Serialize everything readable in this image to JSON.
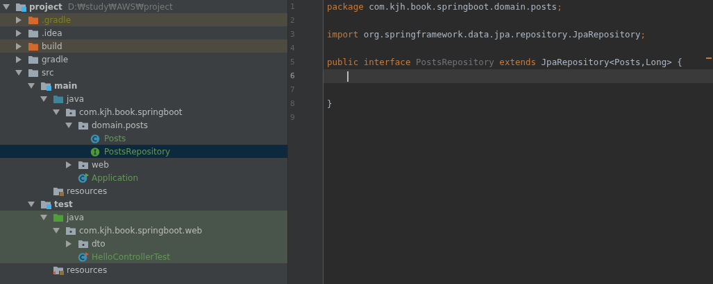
{
  "project_tree": {
    "items": [
      {
        "label": "project",
        "path": "D:₩study₩AWS₩project",
        "kind": "module",
        "color": "#bbbbbb",
        "selected": false,
        "expanded": true,
        "children": [
          {
            "label": ".gradle",
            "kind": "excluded-folder",
            "color": "#848504",
            "selected": false,
            "expanded": false
          },
          {
            "label": ".idea",
            "kind": "folder",
            "color": "#bbbbbb",
            "selected": false,
            "expanded": false
          },
          {
            "label": "build",
            "kind": "excluded-folder",
            "color": "#bbbbbb",
            "selected": false,
            "expanded": false
          },
          {
            "label": "gradle",
            "kind": "folder",
            "color": "#bbbbbb",
            "selected": false,
            "expanded": false
          },
          {
            "label": "src",
            "kind": "folder",
            "color": "#bbbbbb",
            "selected": false,
            "expanded": true,
            "children": [
              {
                "label": "main",
                "kind": "module",
                "color": "#bbbbbb",
                "selected": false,
                "expanded": true,
                "children": [
                  {
                    "label": "java",
                    "kind": "source-root",
                    "color": "#bbbbbb",
                    "selected": false,
                    "expanded": true,
                    "children": [
                      {
                        "label": "com.kjh.book.springboot",
                        "kind": "package",
                        "color": "#bbbbbb",
                        "selected": false,
                        "expanded": true,
                        "children": [
                          {
                            "label": "domain.posts",
                            "kind": "package",
                            "color": "#bbbbbb",
                            "selected": false,
                            "expanded": true,
                            "children": [
                              {
                                "label": "Posts",
                                "kind": "class",
                                "color": "#629755",
                                "selected": false
                              },
                              {
                                "label": "PostsRepository",
                                "kind": "interface",
                                "color": "#629755",
                                "selected": true
                              }
                            ]
                          },
                          {
                            "label": "web",
                            "kind": "package",
                            "color": "#bbbbbb",
                            "selected": false,
                            "expanded": false
                          },
                          {
                            "label": "Application",
                            "kind": "main-class",
                            "color": "#629755",
                            "selected": false
                          }
                        ]
                      }
                    ]
                  },
                  {
                    "label": "resources",
                    "kind": "resources",
                    "color": "#bbbbbb",
                    "selected": false
                  }
                ]
              },
              {
                "label": "test",
                "kind": "module",
                "color": "#bbbbbb",
                "selected": false,
                "expanded": true,
                "children": [
                  {
                    "label": "java",
                    "kind": "test-root",
                    "color": "#bbbbbb",
                    "selected": false,
                    "expanded": true,
                    "children": [
                      {
                        "label": "com.kjh.book.springboot.web",
                        "kind": "package",
                        "color": "#bbbbbb",
                        "selected": false,
                        "expanded": true,
                        "children": [
                          {
                            "label": "dto",
                            "kind": "package",
                            "color": "#bbbbbb",
                            "selected": false,
                            "expanded": false
                          },
                          {
                            "label": "HelloControllerTest",
                            "kind": "test-class",
                            "color": "#629755",
                            "selected": false
                          }
                        ]
                      }
                    ]
                  },
                  {
                    "label": "resources",
                    "kind": "test-resources",
                    "color": "#bbbbbb",
                    "selected": false
                  }
                ]
              }
            ]
          }
        ]
      }
    ]
  },
  "editor": {
    "lines": [
      {
        "number": "1",
        "current": false,
        "tokens": [
          {
            "kind": "keyword",
            "text": "package "
          },
          {
            "kind": "plain",
            "text": "com.kjh.book.springboot.domain.posts"
          },
          {
            "kind": "keyword",
            "text": ";"
          }
        ]
      },
      {
        "number": "2",
        "current": false
      },
      {
        "number": "3",
        "current": false,
        "tokens": [
          {
            "kind": "keyword",
            "text": "import "
          },
          {
            "kind": "plain",
            "text": "org.springframework.data.jpa.repository.JpaRepository"
          },
          {
            "kind": "keyword",
            "text": ";"
          }
        ]
      },
      {
        "number": "4",
        "current": false
      },
      {
        "number": "5",
        "current": false,
        "tokens": [
          {
            "kind": "keyword",
            "text": "public interface "
          },
          {
            "kind": "unused",
            "text": "PostsRepository "
          },
          {
            "kind": "keyword",
            "text": "extends "
          },
          {
            "kind": "plain",
            "text": "JpaRepository<Posts,Long> {"
          }
        ]
      },
      {
        "number": "6",
        "current": true
      },
      {
        "number": "7",
        "current": false
      },
      {
        "number": "8",
        "current": false,
        "tokens": [
          {
            "kind": "plain",
            "text": "}"
          }
        ]
      },
      {
        "number": "9",
        "current": false
      }
    ]
  }
}
